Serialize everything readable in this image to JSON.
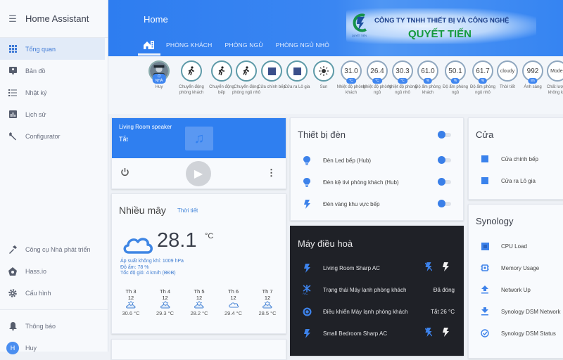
{
  "sidebar": {
    "title": "Home Assistant",
    "items": [
      {
        "label": "Tổng quan",
        "icon": "grid-icon",
        "active": true
      },
      {
        "label": "Bản đồ",
        "icon": "map-icon"
      },
      {
        "label": "Nhật ký",
        "icon": "list-icon"
      },
      {
        "label": "Lịch sử",
        "icon": "chart-icon"
      },
      {
        "label": "Configurator",
        "icon": "wrench-icon"
      }
    ],
    "bottom_items": [
      {
        "label": "Công cụ Nhà phát triển",
        "icon": "hammer-icon"
      },
      {
        "label": "Hass.io",
        "icon": "hassio-icon"
      },
      {
        "label": "Cấu hình",
        "icon": "gear-icon"
      }
    ],
    "notifications": "Thông báo",
    "user": {
      "name": "Huy",
      "initial": "H"
    }
  },
  "header": {
    "title": "Home",
    "tabs": [
      "PHÒNG KHÁCH",
      "PHÒNG NGỦ",
      "PHÒNG NGỦ NHỎ"
    ],
    "logo": {
      "line1": "CÔNG TY TNHH THIẾT BỊ VÀ CÔNG NGHỆ",
      "line2": "QUYẾT TIẾN",
      "small": "QUYẾT TIẾN"
    }
  },
  "badges": [
    {
      "label": "Huy",
      "type": "person",
      "tag": "Ở NHÀ"
    },
    {
      "label": "Chuyển động phòng khách",
      "type": "motion"
    },
    {
      "label": "Chuyển động bếp",
      "type": "motion"
    },
    {
      "label": "Chuyển động phòng ngủ nhỏ",
      "type": "motion"
    },
    {
      "label": "Cửa chính bếp",
      "type": "door"
    },
    {
      "label": "Cửa ra Lô gia",
      "type": "door"
    },
    {
      "label": "Sun",
      "type": "sun"
    },
    {
      "label": "Nhiệt độ phòng khách",
      "value": "31.0",
      "unit": "°C"
    },
    {
      "label": "Nhiệt độ phòng ngủ",
      "value": "26.4",
      "unit": "°C"
    },
    {
      "label": "Nhiệt độ phòng ngủ nhỏ",
      "value": "30.3",
      "unit": "°C"
    },
    {
      "label": "Độ ẩm phòng khách",
      "value": "61.0",
      "unit": "%"
    },
    {
      "label": "Độ ẩm phòng ngủ",
      "value": "50.1",
      "unit": "%"
    },
    {
      "label": "Độ ẩm phòng ngủ nhỏ",
      "value": "61.7",
      "unit": "%"
    },
    {
      "label": "Thời tiết",
      "value": "cloudy"
    },
    {
      "label": "Ánh sáng",
      "value": "992",
      "unit": "lm"
    },
    {
      "label": "Chất lượng không khí",
      "value": "Moder"
    }
  ],
  "speaker": {
    "name": "Living Room speaker",
    "state": "Tắt"
  },
  "weather": {
    "condition": "Nhiều mây",
    "link": "Thời tiết",
    "temp": "28.1",
    "unit": "°C",
    "pressure": "Áp suất không khí: 1009 hPa",
    "humidity": "Độ ẩm: 78 %",
    "wind": "Tốc độ gió: 4 km/h (BĐB)",
    "forecast": [
      {
        "day": "Th 3",
        "date": "12",
        "temp": "30.6 °C",
        "icon": "partly-cloudy"
      },
      {
        "day": "Th 4",
        "date": "12",
        "temp": "29.3 °C",
        "icon": "partly-cloudy"
      },
      {
        "day": "Th 5",
        "date": "12",
        "temp": "28.2 °C",
        "icon": "partly-cloudy"
      },
      {
        "day": "Th 6",
        "date": "12",
        "temp": "29.4 °C",
        "icon": "cloudy"
      },
      {
        "day": "Th 7",
        "date": "12",
        "temp": "28.5 °C",
        "icon": "partly-cloudy"
      }
    ]
  },
  "lights": {
    "title": "Thiết bị đèn",
    "items": [
      {
        "label": "Đèn Led bếp (Hub)",
        "icon": "bulb-icon"
      },
      {
        "label": "Đèn kệ tivi phòng khách (Hub)",
        "icon": "bulb-icon"
      },
      {
        "label": "Đèn vàng khu vực bếp",
        "icon": "flash-icon"
      }
    ]
  },
  "ac": {
    "title": "Máy điều hoà",
    "items": [
      {
        "label": "Living Room Sharp AC",
        "type": "buttons"
      },
      {
        "label": "Trạng thái Máy lạnh phòng khách",
        "value": "Đã đóng"
      },
      {
        "label": "Điều khiển Máy lạnh phòng khách",
        "value": "Tắt 26 °C"
      },
      {
        "label": "Small Bedroom Sharp AC",
        "type": "buttons"
      }
    ]
  },
  "doors": {
    "title": "Cửa",
    "items": [
      "Cửa chính bếp",
      "Cửa ra Lô gia"
    ]
  },
  "synology": {
    "title": "Synology",
    "items": [
      {
        "label": "CPU Load",
        "icon": "cpu-icon"
      },
      {
        "label": "Memory Usage",
        "icon": "memory-icon"
      },
      {
        "label": "Network Up",
        "icon": "upload-icon"
      },
      {
        "label": "Synology DSM Network",
        "icon": "download-icon"
      },
      {
        "label": "Synology DSM Status",
        "icon": "check-circle-icon"
      }
    ]
  }
}
